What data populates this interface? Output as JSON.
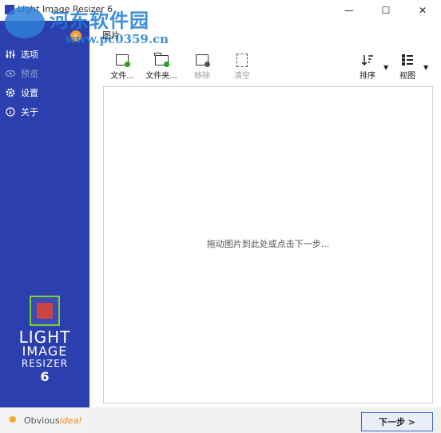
{
  "window": {
    "title": "Light Image Resizer 6",
    "minimize": "—",
    "maximize": "☐",
    "close": "✕"
  },
  "watermark": {
    "text": "河东软件园",
    "url": "www.pc0359.cn"
  },
  "sidebar": {
    "badge": "6",
    "items": [
      {
        "label": "选项",
        "icon": "sliders-icon",
        "enabled": true
      },
      {
        "label": "预览",
        "icon": "eye-icon",
        "enabled": false
      },
      {
        "label": "设置",
        "icon": "gear-icon",
        "enabled": true
      },
      {
        "label": "关于",
        "icon": "info-icon",
        "enabled": true
      }
    ],
    "brand": {
      "line1": "LIGHT",
      "line2": "IMAGE",
      "line3": "RESIZER",
      "line4": "6"
    }
  },
  "footer_brand": {
    "prefix": "Obvious",
    "accent": "idea!"
  },
  "main": {
    "section_title": "图片",
    "toolbar": {
      "add_files": "文件...",
      "add_folder": "文件夹...",
      "remove": "移除",
      "clear": "清空",
      "sort": "排序",
      "view": "视图"
    },
    "drop_hint": "拖动图片到此处或点击下一步...",
    "next_button": "下一步 >"
  },
  "colors": {
    "sidebar": "#2c3fae",
    "accent_green": "#1da81d",
    "accent_orange": "#f39a2b"
  }
}
